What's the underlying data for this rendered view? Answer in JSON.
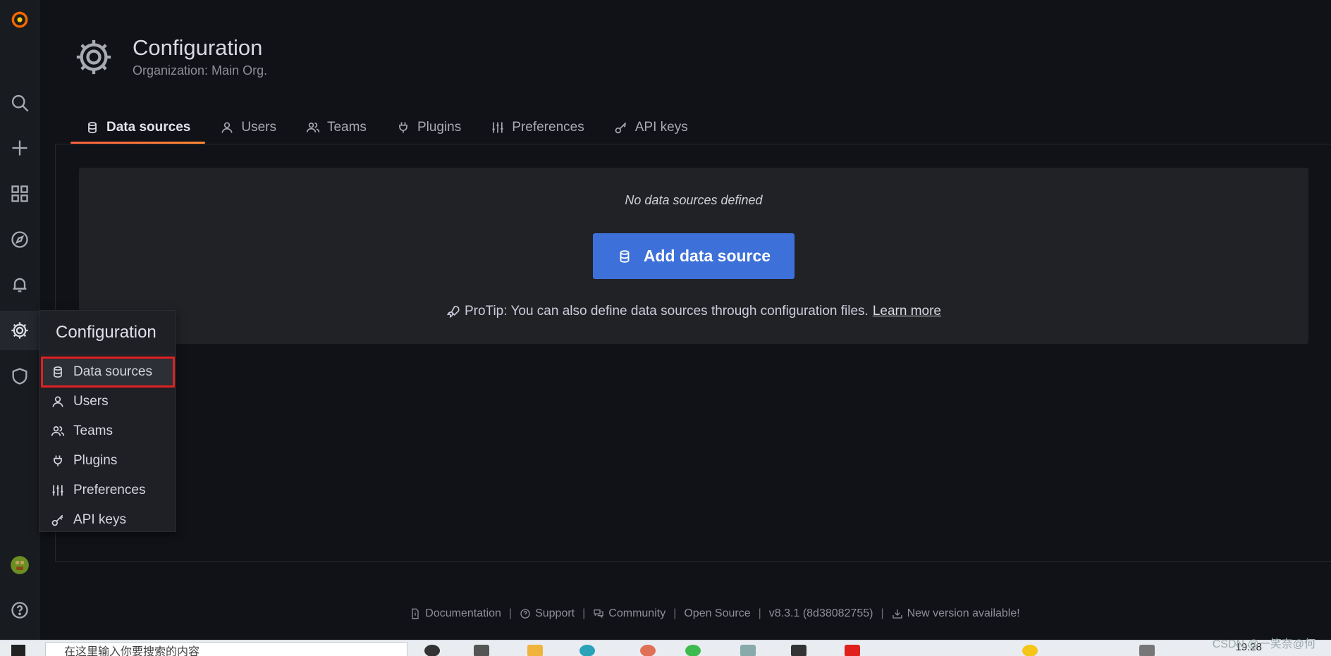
{
  "header": {
    "title": "Configuration",
    "subtitle": "Organization: Main Org."
  },
  "tabs": [
    {
      "label": "Data sources",
      "icon": "database-icon",
      "active": true
    },
    {
      "label": "Users",
      "icon": "user-icon"
    },
    {
      "label": "Teams",
      "icon": "users-icon"
    },
    {
      "label": "Plugins",
      "icon": "plug-icon"
    },
    {
      "label": "Preferences",
      "icon": "sliders-icon"
    },
    {
      "label": "API keys",
      "icon": "key-icon"
    }
  ],
  "empty_state": {
    "message": "No data sources defined",
    "button_label": "Add data source",
    "protip": "ProTip: You can also define data sources through configuration files.",
    "learn_more": "Learn more"
  },
  "menu": {
    "title": "Configuration",
    "items": [
      {
        "label": "Data sources",
        "icon": "database-icon",
        "selected": true
      },
      {
        "label": "Users",
        "icon": "user-icon"
      },
      {
        "label": "Teams",
        "icon": "users-icon"
      },
      {
        "label": "Plugins",
        "icon": "plug-icon"
      },
      {
        "label": "Preferences",
        "icon": "sliders-icon"
      },
      {
        "label": "API keys",
        "icon": "key-icon"
      }
    ]
  },
  "footer": {
    "documentation": "Documentation",
    "support": "Support",
    "community": "Community",
    "open_source": "Open Source",
    "version": "v8.3.1 (8d38082755)",
    "new_version": "New version available!"
  },
  "taskbar": {
    "search_placeholder": "在这里输入你要搜索的内容",
    "time": "19:28"
  },
  "watermark": "CSDN @一笑奈@何",
  "colors": {
    "accent_primary": "#3d71d9",
    "tab_underline": "#ff8833",
    "highlight_box": "#e02020",
    "background": "#111217"
  }
}
